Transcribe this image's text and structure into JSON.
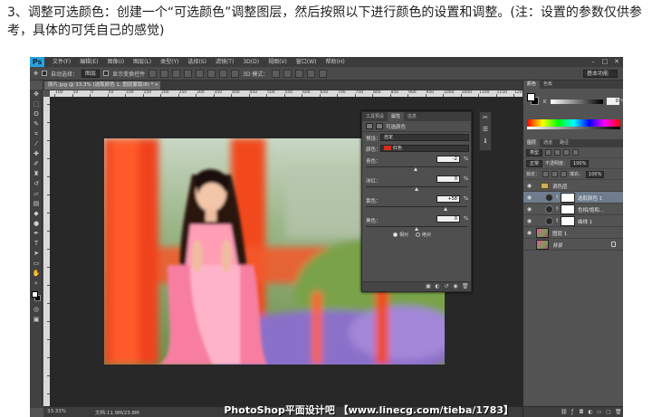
{
  "article": {
    "text": "3、调整可选颜色：创建一个“可选颜色”调整图层，然后按照以下进行颜色的设置和调整。(注：设置的参数仅供参考，具体的可凭自己的感觉)"
  },
  "app": {
    "logo": "Ps",
    "menu": [
      "文件(F)",
      "编辑(E)",
      "图像(I)",
      "图层(L)",
      "类型(Y)",
      "选择(S)",
      "滤镜(T)",
      "3D(D)",
      "视图(V)",
      "窗口(W)",
      "帮助(H)"
    ],
    "options": {
      "auto_select": "自动选择：",
      "auto_select_target": "图层",
      "show_transform": "显示变换控件",
      "mode_3d": "3D 模式：",
      "workspace": "基本功能"
    },
    "document_tab": "原片.jpg @ 33.3% (选取颜色 1, 图层蒙版/8) *",
    "ruler_numbers": [
      "100",
      "50",
      "0",
      "50",
      "100",
      "150",
      "200",
      "250",
      "300",
      "350",
      "400",
      "450",
      "500",
      "550",
      "600",
      "650",
      "700",
      "750",
      "800",
      "850",
      "900",
      "950",
      "1000",
      "1050",
      "1100",
      "1150",
      "1200"
    ],
    "status": {
      "zoom": "33.33%",
      "doc_size": "文档:11.9M/23.8M"
    },
    "watermark": "PhotoShop平面设计吧 【www.linecg.com/tieba/1783】"
  },
  "properties": {
    "tabs": [
      "工具预设",
      "属性",
      "信息"
    ],
    "active_tab": "属性",
    "title": "可选颜色",
    "preset_label": "预设：",
    "preset_value": "自定",
    "colors_label": "颜色：",
    "colors_value": "红色",
    "sliders": [
      {
        "label": "青色：",
        "value": "-2",
        "unit": "%",
        "level": -2
      },
      {
        "label": "洋红：",
        "value": "0",
        "unit": "%",
        "level": 0
      },
      {
        "label": "黄色：",
        "value": "+58",
        "unit": "%",
        "level": 58
      },
      {
        "label": "黑色：",
        "value": "0",
        "unit": "%",
        "level": 0
      }
    ],
    "method": [
      {
        "label": "相对",
        "selected": true
      },
      {
        "label": "绝对",
        "selected": false
      }
    ]
  },
  "color_panel": {
    "tabs": [
      "颜色",
      "色板"
    ],
    "k_label": "K",
    "k_value": "0",
    "k_unit": "%"
  },
  "layers_panel": {
    "tabs": [
      "图层",
      "通道",
      "路径"
    ],
    "filter_kind": "类型",
    "blend_mode": "正常",
    "opacity_label": "不透明度：",
    "opacity_value": "100%",
    "lock_label": "锁定：",
    "fill_label": "填充：",
    "fill_value": "100%",
    "layers": [
      {
        "name": "调色层",
        "kind": "group",
        "selected": false,
        "visible": true
      },
      {
        "name": "选取颜色 1",
        "kind": "adjustment",
        "selected": true,
        "visible": true
      },
      {
        "name": "色相/饱和...",
        "kind": "adjustment",
        "selected": false,
        "visible": true
      },
      {
        "name": "曲线 1",
        "kind": "adjustment",
        "selected": false,
        "visible": true
      },
      {
        "name": "图层 1",
        "kind": "pixel",
        "selected": false,
        "visible": true
      },
      {
        "name": "背景",
        "kind": "background",
        "selected": false,
        "visible": false
      }
    ]
  }
}
